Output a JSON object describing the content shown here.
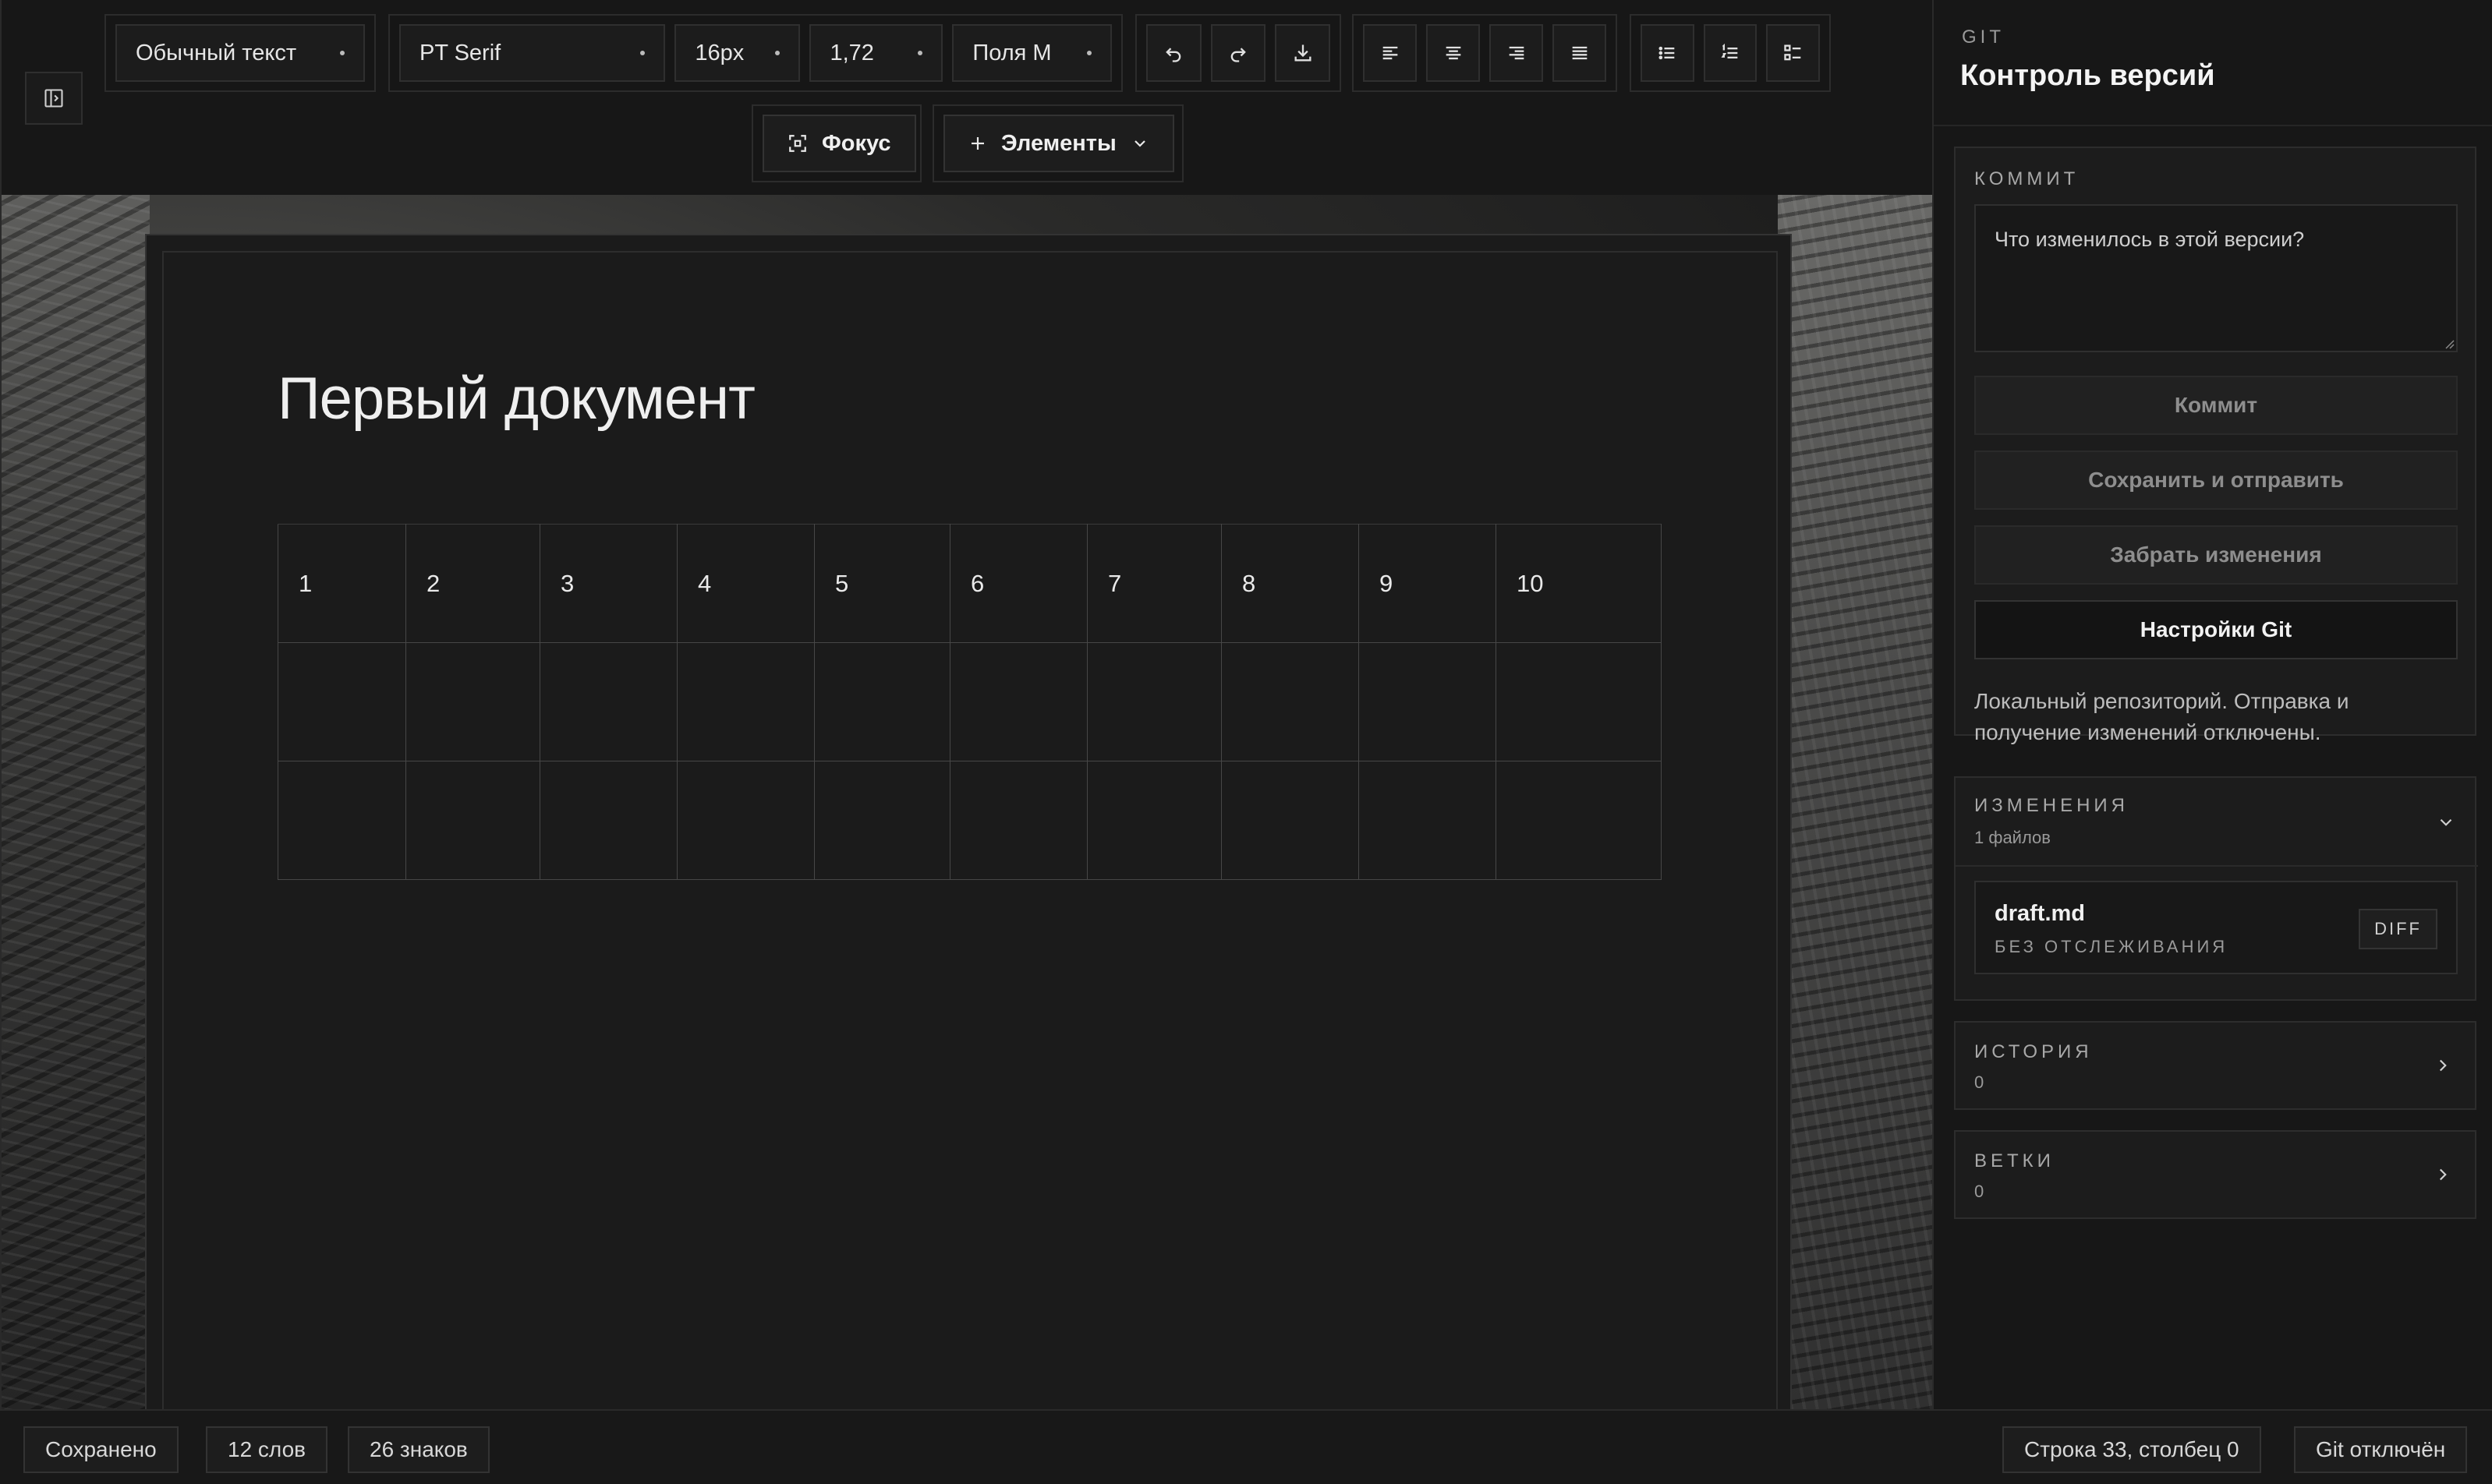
{
  "toolbar": {
    "style_select": "Обычный текст",
    "font_select": "PT Serif",
    "size_select": "16px",
    "line_height_select": "1,72",
    "margins_select": "Поля M",
    "focus_label": "Фокус",
    "elements_label": "Элементы"
  },
  "document": {
    "title": "Первый документ",
    "table": {
      "header": [
        "1",
        "2",
        "3",
        "4",
        "5",
        "6",
        "7",
        "8",
        "9",
        "10"
      ],
      "rows": [
        [
          "",
          "",
          "",
          "",
          "",
          "",
          "",
          "",
          "",
          ""
        ],
        [
          "",
          "",
          "",
          "",
          "",
          "",
          "",
          "",
          "",
          ""
        ]
      ]
    }
  },
  "status": {
    "saved": "Сохранено",
    "words": "12 слов",
    "chars": "26 знаков",
    "position": "Строка 33, столбец 0",
    "git": "Git отключён"
  },
  "git_panel": {
    "eyebrow": "GIT",
    "title": "Контроль версий",
    "commit": {
      "heading": "КОММИТ",
      "placeholder": "Что изменилось в этой версии?",
      "commit_btn": "Коммит",
      "save_push_btn": "Сохранить и отправить",
      "pull_btn": "Забрать изменения",
      "settings_btn": "Настройки Git",
      "note": "Локальный репозиторий. Отправка и получение изменений отключены."
    },
    "changes": {
      "heading": "ИЗМЕНЕНИЯ",
      "count": "1 файлов",
      "files": [
        {
          "name": "draft.md",
          "status": "БЕЗ ОТСЛЕЖИВАНИЯ",
          "action": "DIFF"
        }
      ]
    },
    "history": {
      "heading": "ИСТОРИЯ",
      "count": "0"
    },
    "branches": {
      "heading": "ВЕТКИ",
      "count": "0"
    }
  }
}
